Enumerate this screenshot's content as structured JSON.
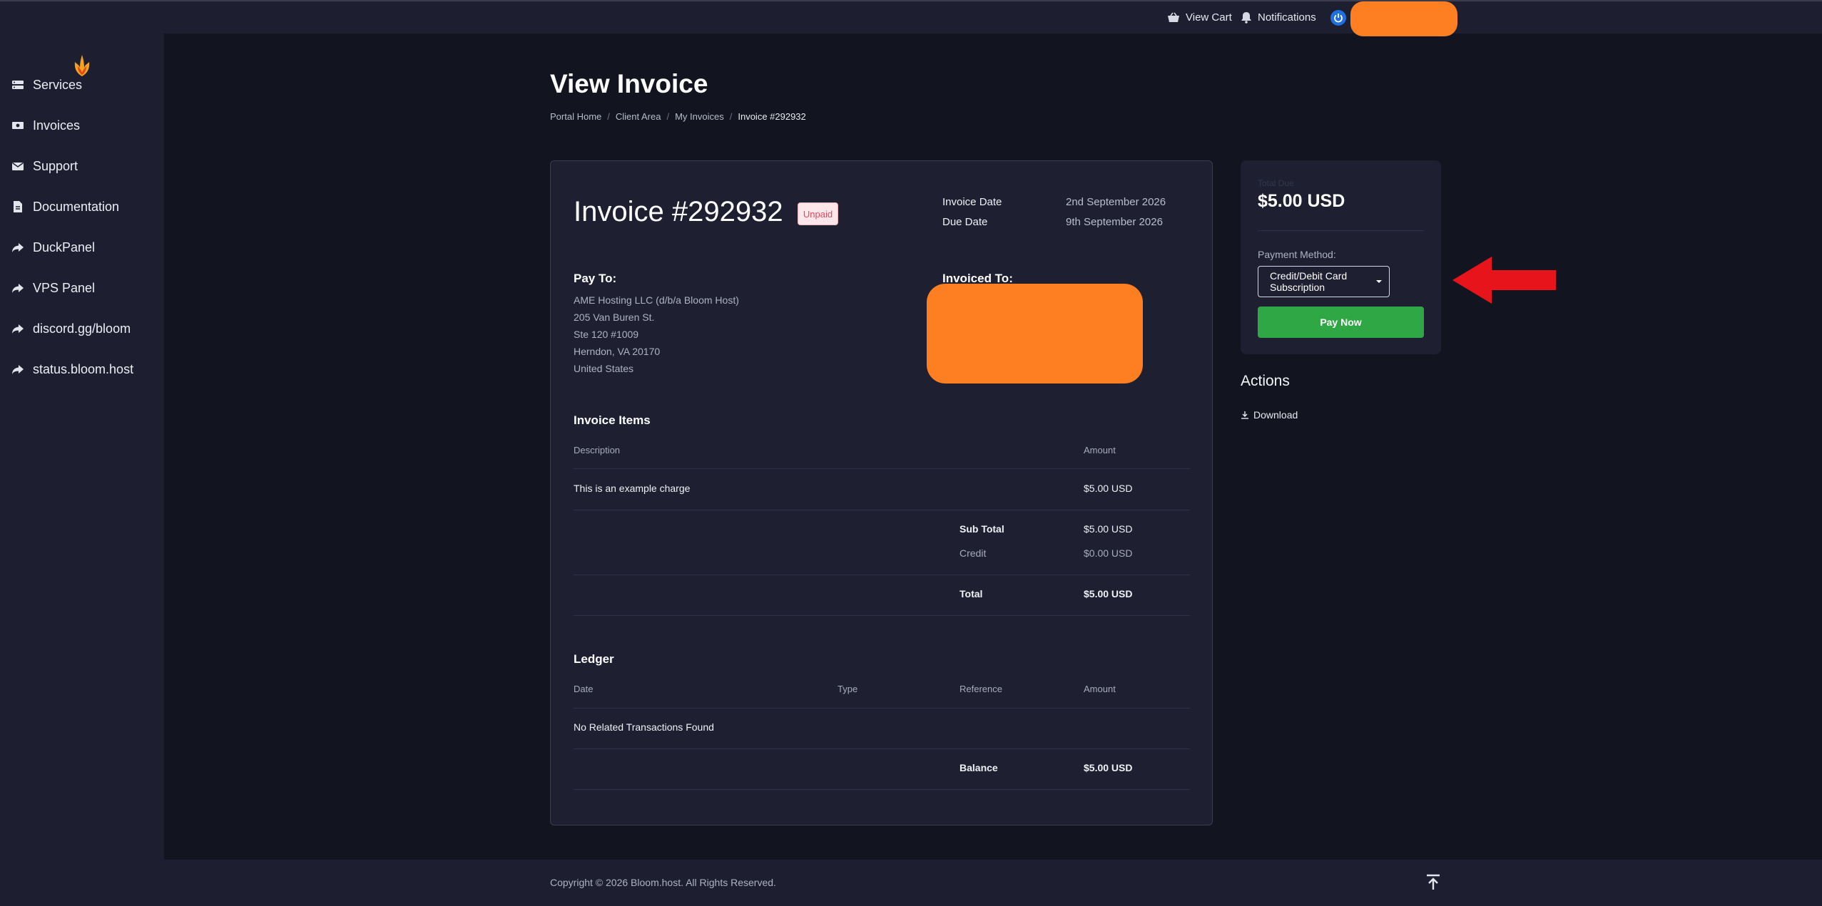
{
  "topbar": {
    "view_cart": "View Cart",
    "notifications": "Notifications",
    "icons": [
      "basket-icon",
      "bell-icon",
      "power-icon"
    ]
  },
  "sidebar": {
    "items": [
      {
        "label": "Services",
        "icon": "server-icon"
      },
      {
        "label": "Invoices",
        "icon": "money-icon"
      },
      {
        "label": "Support",
        "icon": "envelope-icon"
      },
      {
        "label": "Documentation",
        "icon": "document-icon"
      },
      {
        "label": "DuckPanel",
        "icon": "share-arrow-icon"
      },
      {
        "label": "VPS Panel",
        "icon": "share-arrow-icon"
      },
      {
        "label": "discord.gg/bloom",
        "icon": "share-arrow-icon"
      },
      {
        "label": "status.bloom.host",
        "icon": "share-arrow-icon"
      }
    ]
  },
  "page": {
    "title": "View Invoice",
    "breadcrumb": [
      "Portal Home",
      "Client Area",
      "My Invoices",
      "Invoice #292932"
    ]
  },
  "invoice": {
    "title": "Invoice #292932",
    "status": "Unpaid",
    "invoice_date_label": "Invoice Date",
    "invoice_date": "2nd September 2026",
    "due_date_label": "Due Date",
    "due_date": "9th September 2026",
    "pay_to_label": "Pay To:",
    "pay_to": [
      "AME Hosting LLC (d/b/a Bloom Host)",
      "205 Van Buren St.",
      "Ste 120 #1009",
      "Herndon, VA 20170",
      "United States"
    ],
    "invoiced_to_label": "Invoiced To:",
    "items_title": "Invoice Items",
    "items_headers": {
      "description": "Description",
      "amount": "Amount"
    },
    "items": [
      {
        "description": "This is an example charge",
        "amount": "$5.00 USD"
      }
    ],
    "sub_total_label": "Sub Total",
    "sub_total": "$5.00 USD",
    "credit_label": "Credit",
    "credit": "$0.00 USD",
    "total_label": "Total",
    "total": "$5.00 USD",
    "ledger_title": "Ledger",
    "ledger_headers": {
      "date": "Date",
      "type": "Type",
      "reference": "Reference",
      "amount": "Amount"
    },
    "ledger_empty": "No Related Transactions Found",
    "balance_label": "Balance",
    "balance": "$5.00 USD"
  },
  "payment": {
    "total_due_label": "Total Due",
    "total_due": "$5.00 USD",
    "method_label": "Payment Method:",
    "method_selected": "Credit/Debit Card Subscription",
    "pay_button": "Pay Now"
  },
  "actions": {
    "title": "Actions",
    "download": "Download"
  },
  "footer": {
    "copyright": "Copyright © 2026 Bloom.host. All Rights Reserved."
  },
  "colors": {
    "background": "#121420",
    "panel": "#1e2031",
    "accent_green": "#2ea744",
    "redaction_orange": "#fd7f22",
    "annotation_red": "#e8141c"
  }
}
